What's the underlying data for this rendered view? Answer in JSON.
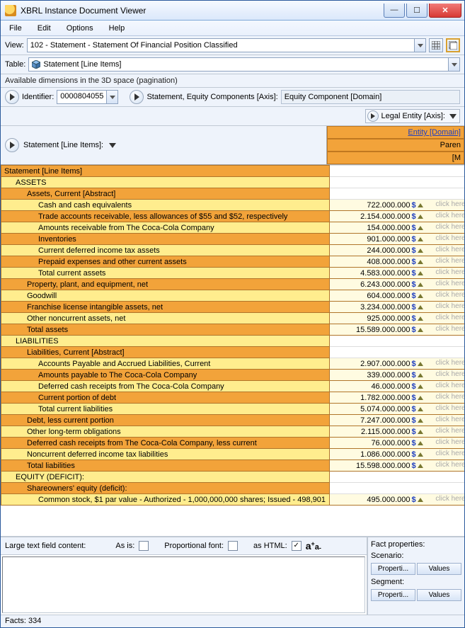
{
  "window": {
    "title": "XBRL Instance Document Viewer"
  },
  "menu": {
    "file": "File",
    "edit": "Edit",
    "options": "Options",
    "help": "Help"
  },
  "toolbar": {
    "view_label": "View:",
    "view_value": "102 - Statement - Statement Of Financial Position Classified",
    "table_label": "Table:",
    "table_value": "Statement [Line Items]"
  },
  "dimensions_hint": "Available dimensions in the 3D space (pagination)",
  "axis": {
    "identifier_label": "Identifier:",
    "identifier_value": "0000804055",
    "equity_label": "Statement, Equity Components [Axis]:",
    "equity_value": "Equity Component [Domain]",
    "legal_label": "Legal Entity [Axis]:",
    "entity_header": "Entity [Domain]",
    "paren_header": "Paren",
    "m_header": "[M",
    "statement_axis_label": "Statement [Line Items]:"
  },
  "columns": {
    "val_suffix": "$",
    "click_hint": "click here"
  },
  "rows": [
    {
      "label": "Statement [Line Items]",
      "cls": "label",
      "ind": 0,
      "val": null
    },
    {
      "label": "ASSETS",
      "cls": "labelY",
      "ind": 1,
      "val": null
    },
    {
      "label": "Assets, Current [Abstract]",
      "cls": "label",
      "ind": 2,
      "val": null
    },
    {
      "label": "Cash and cash equivalents",
      "cls": "labelY",
      "ind": 3,
      "val": "722.000.000"
    },
    {
      "label": "Trade accounts receivable, less allowances of $55 and $52, respectively",
      "cls": "label",
      "ind": 3,
      "val": "2.154.000.000"
    },
    {
      "label": "Amounts receivable from The Coca-Cola Company",
      "cls": "labelY",
      "ind": 3,
      "val": "154.000.000"
    },
    {
      "label": "Inventories",
      "cls": "label",
      "ind": 3,
      "val": "901.000.000"
    },
    {
      "label": "Current deferred income tax assets",
      "cls": "labelY",
      "ind": 3,
      "val": "244.000.000"
    },
    {
      "label": "Prepaid expenses and other current assets",
      "cls": "label",
      "ind": 3,
      "val": "408.000.000"
    },
    {
      "label": "Total current assets",
      "cls": "labelY",
      "ind": 3,
      "val": "4.583.000.000"
    },
    {
      "label": "Property, plant, and equipment, net",
      "cls": "label",
      "ind": 2,
      "val": "6.243.000.000"
    },
    {
      "label": "Goodwill",
      "cls": "labelY",
      "ind": 2,
      "val": "604.000.000"
    },
    {
      "label": "Franchise license intangible assets, net",
      "cls": "label",
      "ind": 2,
      "val": "3.234.000.000"
    },
    {
      "label": "Other noncurrent assets, net",
      "cls": "labelY",
      "ind": 2,
      "val": "925.000.000"
    },
    {
      "label": "Total assets",
      "cls": "label",
      "ind": 2,
      "val": "15.589.000.000"
    },
    {
      "label": "LIABILITIES",
      "cls": "labelY",
      "ind": 1,
      "val": null
    },
    {
      "label": "Liabilities, Current [Abstract]",
      "cls": "label",
      "ind": 2,
      "val": null
    },
    {
      "label": "Accounts Payable and Accrued Liabilities, Current",
      "cls": "labelY",
      "ind": 3,
      "val": "2.907.000.000"
    },
    {
      "label": "Amounts payable to The Coca-Cola Company",
      "cls": "label",
      "ind": 3,
      "val": "339.000.000"
    },
    {
      "label": "Deferred cash receipts from The Coca-Cola Company",
      "cls": "labelY",
      "ind": 3,
      "val": "46.000.000"
    },
    {
      "label": "Current portion of debt",
      "cls": "label",
      "ind": 3,
      "val": "1.782.000.000"
    },
    {
      "label": "Total current liabilities",
      "cls": "labelY",
      "ind": 3,
      "val": "5.074.000.000"
    },
    {
      "label": "Debt, less current portion",
      "cls": "label",
      "ind": 2,
      "val": "7.247.000.000"
    },
    {
      "label": "Other long-term obligations",
      "cls": "labelY",
      "ind": 2,
      "val": "2.115.000.000"
    },
    {
      "label": "Deferred cash receipts from The Coca-Cola Company, less current",
      "cls": "label",
      "ind": 2,
      "val": "76.000.000"
    },
    {
      "label": "Noncurrent deferred income tax liabilities",
      "cls": "labelY",
      "ind": 2,
      "val": "1.086.000.000"
    },
    {
      "label": "Total liabilities",
      "cls": "label",
      "ind": 2,
      "val": "15.598.000.000"
    },
    {
      "label": "EQUITY (DEFICIT):",
      "cls": "labelY",
      "ind": 1,
      "val": null
    },
    {
      "label": "Shareowners' equity (deficit):",
      "cls": "label",
      "ind": 2,
      "val": null
    },
    {
      "label": "Common stock, $1 par value - Authorized - 1,000,000,000 shares; Issued - 498,901",
      "cls": "labelY",
      "ind": 3,
      "val": "495.000.000"
    }
  ],
  "bottom": {
    "large_text_label": "Large text field content:",
    "asis_label": "As is:",
    "prop_label": "Proportional font:",
    "ashtml_label": "as HTML:",
    "fact_title": "Fact properties:",
    "scenario": "Scenario:",
    "segment": "Segment:",
    "properties_btn": "Properti...",
    "values_btn": "Values"
  },
  "status": {
    "facts": "Facts: 334"
  }
}
